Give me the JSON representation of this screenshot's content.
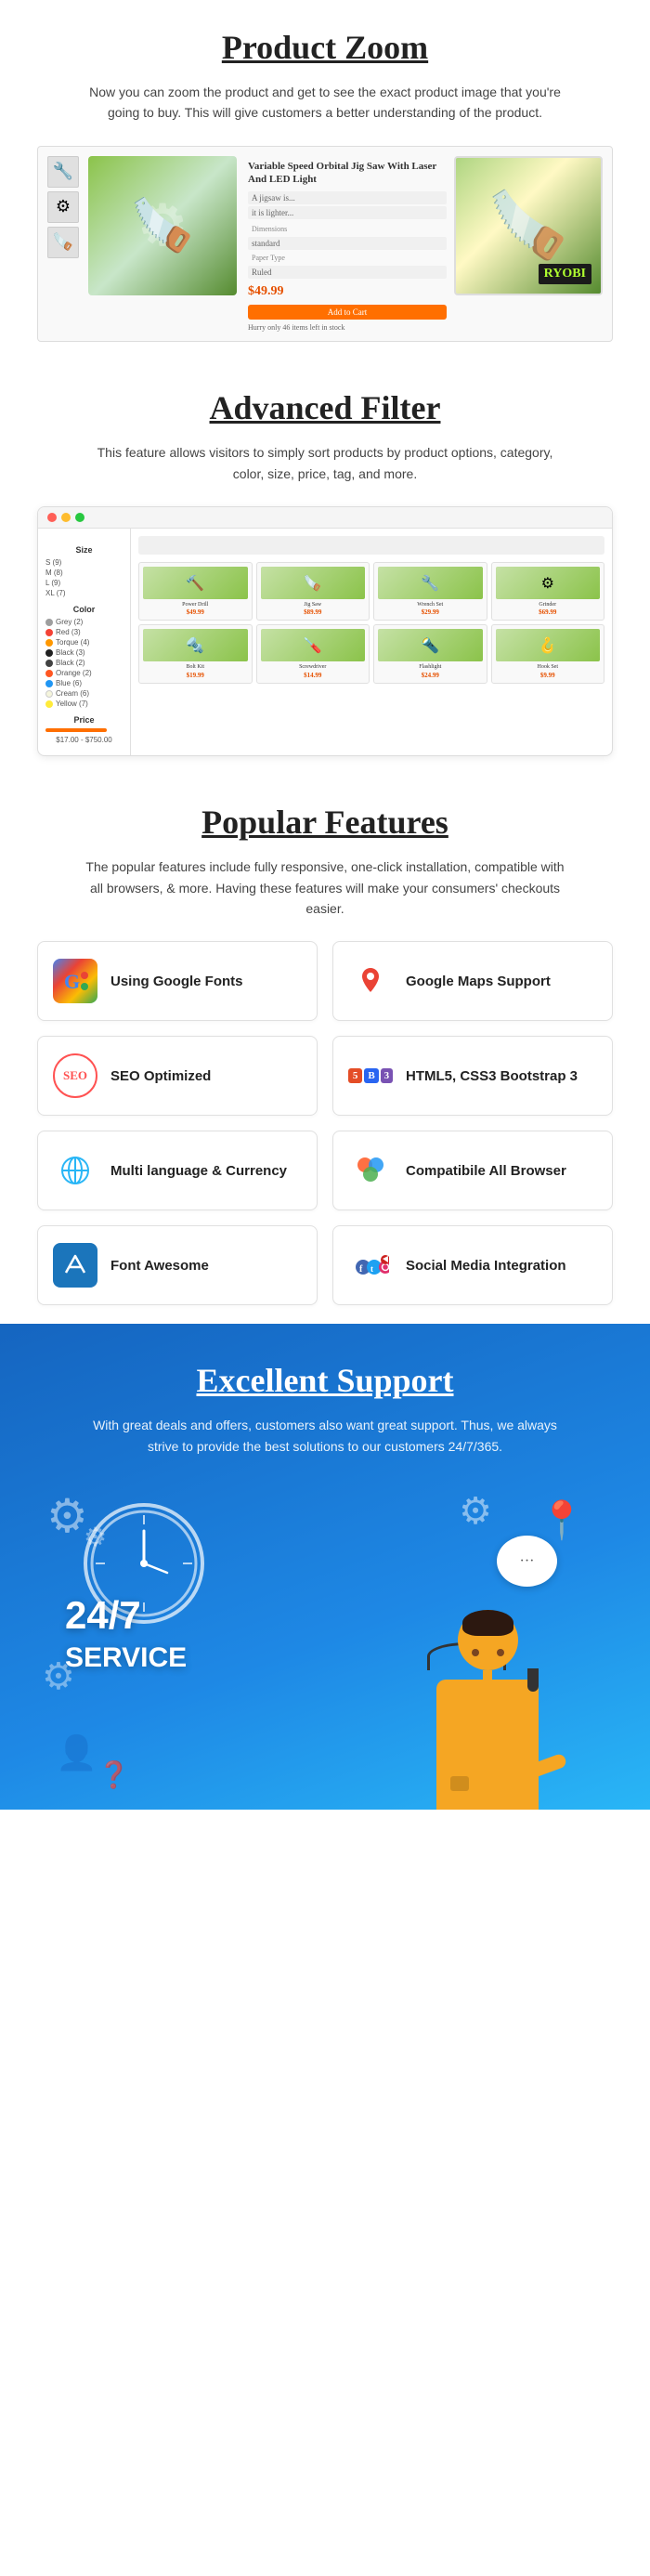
{
  "sections": {
    "product_zoom": {
      "title": "Product Zoom",
      "description": "Now you can zoom the product and get to see the exact product image that you're going to buy. This will give customers a better understanding of the product.",
      "product_title": "Variable Speed Orbital Jig Saw With Laser And LED Light",
      "brand": "RYOBI"
    },
    "advanced_filter": {
      "title": "Advanced Filter",
      "description": "This feature allows visitors to simply sort products by product options, category, color, size, price, tag, and more.",
      "filters": {
        "size_label": "Size",
        "sizes": [
          "S (9)",
          "M (8)",
          "L (9)",
          "XL (7)"
        ],
        "color_label": "Color",
        "colors": [
          {
            "name": "Grey (2)",
            "hex": "#9e9e9e"
          },
          {
            "name": "Red (3)",
            "hex": "#f44336"
          },
          {
            "name": "Torque (4)",
            "hex": "#ff9800"
          },
          {
            "name": "Black (3)",
            "hex": "#212121"
          },
          {
            "name": "Black (2)",
            "hex": "#424242"
          },
          {
            "name": "Orange (2)",
            "hex": "#ff5722"
          },
          {
            "name": "Blue (6)",
            "hex": "#2196f3"
          },
          {
            "name": "Cream (6)",
            "hex": "#f5f5dc"
          },
          {
            "name": "Yellow (7)",
            "hex": "#ffeb3b"
          }
        ],
        "price_label": "Price",
        "price_range": "$17.00 - $750.00"
      }
    },
    "popular_features": {
      "title": "Popular Features",
      "description": "The popular features include  fully responsive, one-click installation, compatible with all browsers, & more. Having these features will make your consumers' checkouts easier.",
      "features": [
        {
          "id": "google-fonts",
          "label": "Using Google Fonts",
          "icon": "🌐"
        },
        {
          "id": "google-maps",
          "label": "Google Maps Support",
          "icon": "📍"
        },
        {
          "id": "seo",
          "label": "SEO Optimized",
          "icon": "SEO"
        },
        {
          "id": "html5",
          "label": "HTML5, CSS3 Bootstrap 3",
          "icon": "HTML5"
        },
        {
          "id": "multilang",
          "label": "Multi language & Currency",
          "icon": "🌐"
        },
        {
          "id": "browser",
          "label": "Compatibile All Browser",
          "icon": "🌐"
        },
        {
          "id": "fontawesome",
          "label": "Font Awesome",
          "icon": "⚑"
        },
        {
          "id": "social",
          "label": "Social Media Integration",
          "icon": "📱"
        }
      ]
    },
    "support": {
      "title": "Excellent Support",
      "description": "With great deals and offers, customers also want great support. Thus, we always strive to provide the best solutions to our customers 24/7/365.",
      "service_247": "24/7",
      "service_label": "SERVICE"
    }
  }
}
